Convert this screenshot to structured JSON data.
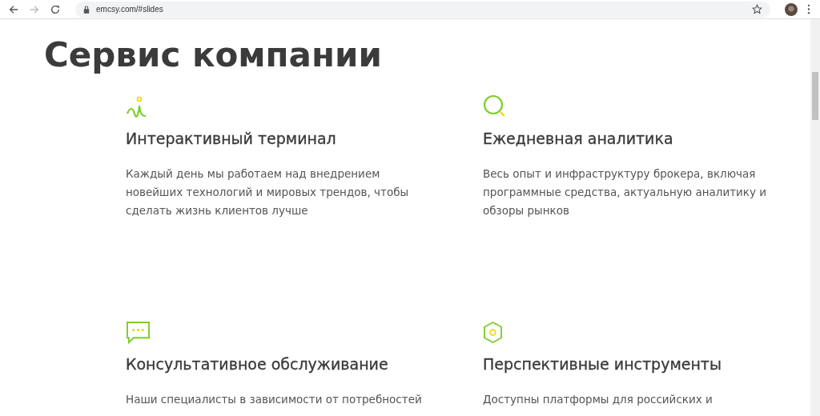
{
  "browser": {
    "url": "emcsy.com/#slides"
  },
  "page": {
    "title": "Сервис компании",
    "services": [
      {
        "kind": "wave",
        "title": "Интерактивный терминал",
        "description": "Каждый день мы работаем над внедрением новейших технологий и мировых трендов, чтобы сделать жизнь клиентов лучше"
      },
      {
        "kind": "search",
        "title": "Ежедневная аналитика",
        "description": "Весь опыт и инфраструктуру брокера, включая программные средства, актуальную аналитику и обзоры рынков"
      },
      {
        "kind": "chat",
        "title": "Консультативное обслуживание",
        "description": "Наши специалисты в зависимости от потребностей"
      },
      {
        "kind": "hexagon",
        "title": "Перспективные инструменты",
        "description": "Доступны платформы для российских и"
      }
    ]
  }
}
